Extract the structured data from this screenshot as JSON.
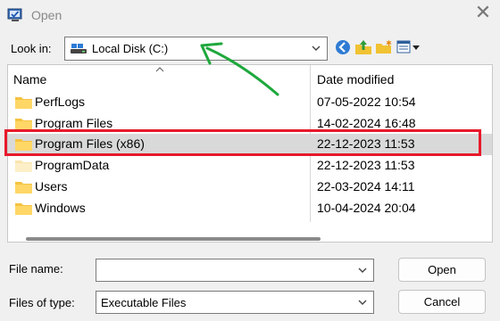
{
  "window": {
    "title": "Open",
    "close_glyph": "✕"
  },
  "look_in": {
    "label": "Look in:",
    "value": "Local Disk (C:)"
  },
  "toolbar": [
    "back-icon",
    "up-folder-icon",
    "new-folder-icon",
    "view-menu-icon"
  ],
  "columns": {
    "name": "Name",
    "date_modified": "Date modified"
  },
  "files": [
    {
      "name": "PerfLogs",
      "date": "07-05-2022 10:54",
      "selected": false
    },
    {
      "name": "Program Files",
      "date": "14-02-2024 16:48",
      "selected": false
    },
    {
      "name": "Program Files (x86)",
      "date": "22-12-2023 11:53",
      "selected": true
    },
    {
      "name": "ProgramData",
      "date": "22-12-2023 11:53",
      "selected": false
    },
    {
      "name": "Users",
      "date": "22-03-2024 14:11",
      "selected": false
    },
    {
      "name": "Windows",
      "date": "10-04-2024 20:04",
      "selected": false
    }
  ],
  "file_name": {
    "label": "File name:",
    "value": ""
  },
  "file_type": {
    "label": "Files of type:",
    "value": "Executable Files"
  },
  "buttons": {
    "open": "Open",
    "cancel": "Cancel"
  },
  "annotations": {
    "highlight_color": "#e8192b",
    "arrow_color": "#1ea83c"
  }
}
